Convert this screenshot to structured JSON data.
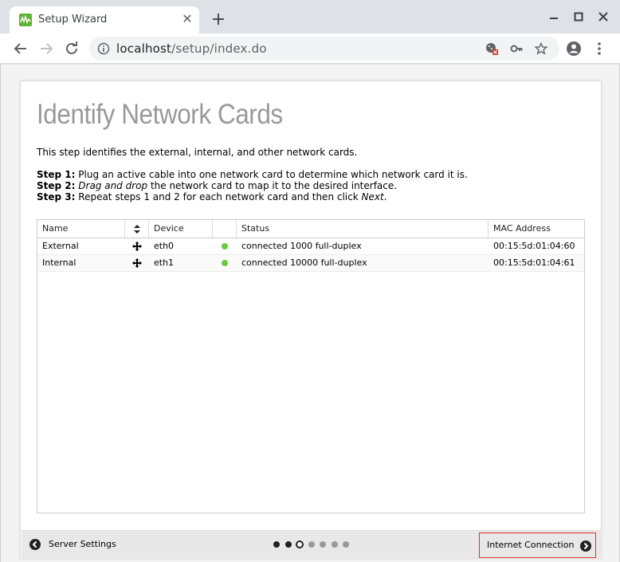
{
  "browser": {
    "tab_title": "Setup Wizard",
    "url_host": "localhost",
    "url_path": "/setup/index.do"
  },
  "page": {
    "title": "Identify Network Cards",
    "intro": "This step identifies the external, internal, and other network cards.",
    "steps": [
      {
        "label": "Step 1:",
        "text": "Plug an active cable into one network card to determine which network card it is."
      },
      {
        "label": "Step 2:",
        "emph": "Drag and drop",
        "text": " the network card to map it to the desired interface."
      },
      {
        "label": "Step 3:",
        "text": "Repeat steps 1 and 2 for each network card and then click ",
        "emph": "Next",
        "tail": "."
      }
    ]
  },
  "grid": {
    "columns": {
      "name": "Name",
      "device": "Device",
      "status": "Status",
      "mac": "MAC Address"
    },
    "rows": [
      {
        "name": "External",
        "device": "eth0",
        "status": "connected 1000 full-duplex",
        "mac": "00:15:5d:01:04:60"
      },
      {
        "name": "Internal",
        "device": "eth1",
        "status": "connected 10000 full-duplex",
        "mac": "00:15:5d:01:04:61"
      }
    ]
  },
  "footer": {
    "prev_label": "Server Settings",
    "next_label": "Internet Connection",
    "progress": {
      "total_steps": 7,
      "current_step": 3
    }
  },
  "colors": {
    "status_ok": "#66cc33",
    "highlight": "#e53030",
    "favicon": "#5fb332"
  }
}
